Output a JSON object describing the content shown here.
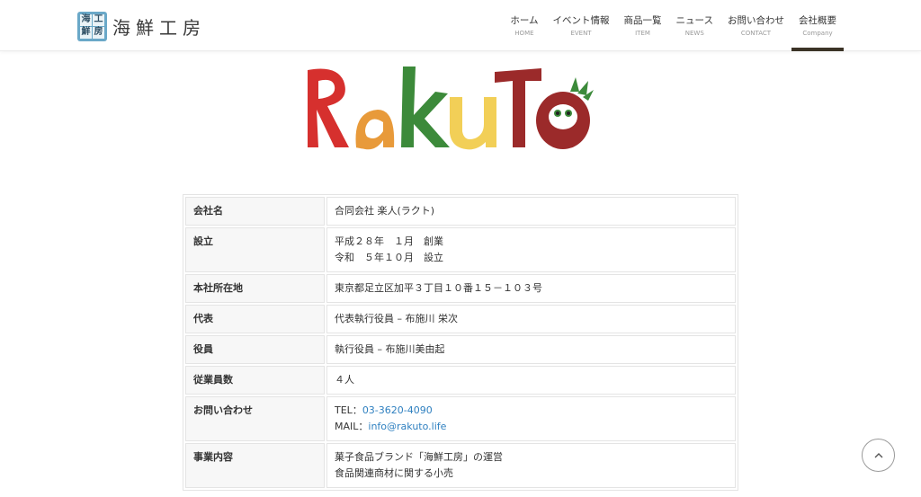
{
  "header": {
    "logo_chars": [
      "海",
      "工",
      "鮮",
      "房"
    ],
    "logo_text": "海鮮工房",
    "nav": [
      {
        "jp": "ホーム",
        "en": "HOME",
        "active": false
      },
      {
        "jp": "イベント情報",
        "en": "EVENT",
        "active": false
      },
      {
        "jp": "商品一覧",
        "en": "ITEM",
        "active": false
      },
      {
        "jp": "ニュース",
        "en": "NEWS",
        "active": false
      },
      {
        "jp": "お問い合わせ",
        "en": "CONTACT",
        "active": false
      },
      {
        "jp": "会社概要",
        "en": "Company",
        "active": true
      }
    ]
  },
  "brand": {
    "wordmark": "RakuTo",
    "colors": [
      "#d6302e",
      "#e89a3a",
      "#3c8a3a",
      "#f2cf57",
      "#9b2a2a",
      "#9b2a2a"
    ]
  },
  "company": {
    "rows": [
      {
        "label": "会社名",
        "lines": [
          "合同会社 楽人(ラクト)"
        ]
      },
      {
        "label": "設立",
        "lines": [
          "平成２８年　１月　創業",
          "令和　５年１０月　設立"
        ]
      },
      {
        "label": "本社所在地",
        "lines": [
          "東京都足立区加平３丁目１０番１５－１０３号"
        ]
      },
      {
        "label": "代表",
        "lines": [
          "代表執行役員 – 布施川 栄次"
        ]
      },
      {
        "label": "役員",
        "lines": [
          "執行役員 – 布施川美由起"
        ]
      },
      {
        "label": "従業員数",
        "lines": [
          "４人"
        ]
      },
      {
        "label": "お問い合わせ",
        "tel_prefix": "TEL：",
        "tel": "03-3620-4090",
        "mail_prefix": "MAIL：",
        "mail": "info@rakuto.life"
      },
      {
        "label": "事業内容",
        "lines": [
          "菓子食品ブランド「海鮮工房」の運営",
          "食品関連商材に関する小売"
        ]
      }
    ]
  },
  "icons": {
    "to_top": "chevron-up-icon"
  },
  "colors": {
    "link": "#2f80c0",
    "nav_active_bar": "#3b3326",
    "label_bg": "#f7f7f7"
  }
}
